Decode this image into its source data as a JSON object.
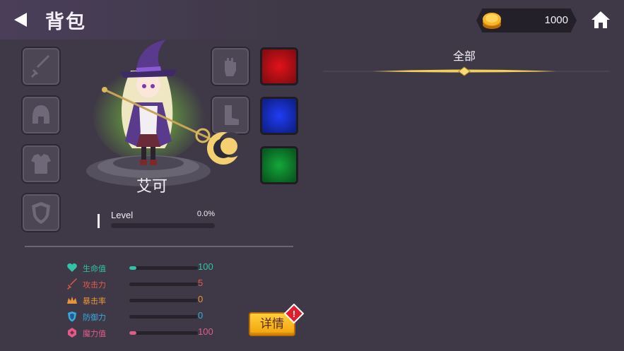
{
  "header": {
    "title": "背包",
    "coins": "1000"
  },
  "character": {
    "name": "艾可",
    "level_label": "Level",
    "level_percent": "0.0%",
    "level_progress": 0.0
  },
  "stats": [
    {
      "icon": "heart-icon",
      "label": "生命值",
      "value": "100",
      "fill": 0.1,
      "color": "#2ec4a6"
    },
    {
      "icon": "sword-icon",
      "label": "攻击力",
      "value": "5",
      "fill": 0.0,
      "color": "#e05c47"
    },
    {
      "icon": "crit-flame-icon",
      "label": "暴击率",
      "value": "0",
      "fill": 0.0,
      "color": "#e8953a"
    },
    {
      "icon": "shield-icon",
      "label": "防御力",
      "value": "0",
      "fill": 0.0,
      "color": "#3aa8e0"
    },
    {
      "icon": "magic-gem-icon",
      "label": "魔力值",
      "value": "100",
      "fill": 0.1,
      "color": "#e05c8a"
    }
  ],
  "actions": {
    "detail_label": "详情",
    "alert_badge": "!"
  },
  "inventory": {
    "tabs": [
      {
        "label": "全部"
      }
    ]
  },
  "colors": {
    "background": "#3f3947",
    "gold": "#f2a20b",
    "gem_red": "#e2121a",
    "gem_blue": "#1f3df5",
    "gem_green": "#12a83a"
  }
}
